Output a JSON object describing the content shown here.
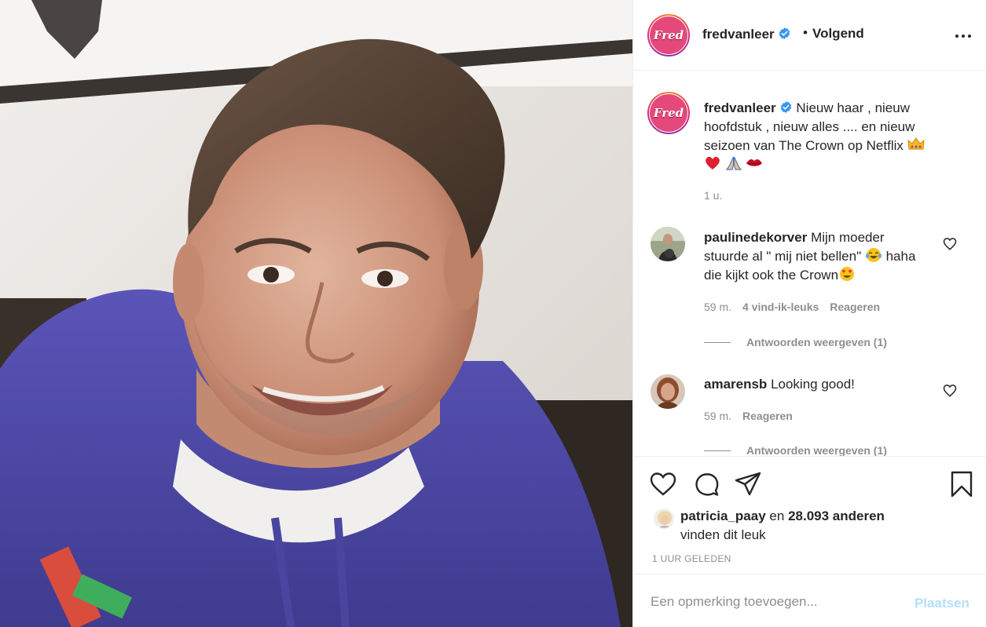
{
  "post": {
    "photo_alt": "Selfie of man in purple hoodie",
    "header": {
      "username": "fredvanleer",
      "follow_status": "Volgend",
      "separator": "•",
      "avatar_logo_text": "Fred"
    },
    "caption": {
      "username": "fredvanleer",
      "text": "Nieuw haar , nieuw hoofdstuk , nieuw alles .... en nieuw seizoen van The Crown op Netflix",
      "time": "1 u."
    },
    "comments": [
      {
        "username": "paulinedekorver",
        "text_1": "Mijn moeder stuurde al \" mij niet bellen\"",
        "text_2": "haha die kijkt ook the Crown",
        "time": "59 m.",
        "likes": "4 vind-ik-leuks",
        "reply_label": "Reageren",
        "view_replies": "Antwoorden weergeven (1)"
      },
      {
        "username": "amarensb",
        "text": "Looking good!",
        "time": "59 m.",
        "reply_label": "Reageren",
        "view_replies": "Antwoorden weergeven (1)"
      }
    ],
    "likes": {
      "liker": "patricia_paay",
      "connector": "en",
      "others": "28.093 anderen",
      "suffix": "vinden dit leuk"
    },
    "posted_ago": "1 UUR GELEDEN",
    "add_comment": {
      "placeholder": "Een opmerking toevoegen...",
      "submit_label": "Plaatsen"
    }
  },
  "colors": {
    "text": "#262626",
    "secondary": "#8e8e8e",
    "verified": "#3897f0",
    "post_button_disabled": "#b2dffc",
    "avatar_pink": "#e5487a"
  },
  "icons": [
    "more-options-icon",
    "verified-badge-icon",
    "heart-icon",
    "comment-icon",
    "share-icon",
    "bookmark-icon",
    "crown-emoji",
    "red-heart-emoji",
    "folded-hands-emoji",
    "lips-emoji",
    "tears-of-joy-emoji",
    "heart-eyes-emoji"
  ]
}
